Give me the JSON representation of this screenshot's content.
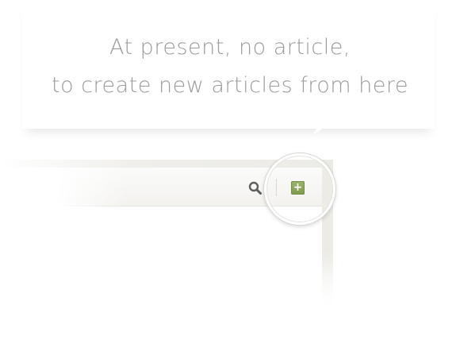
{
  "empty_state": {
    "line1": "At present, no article,",
    "line2": "to create new articles from here"
  },
  "toolbar": {
    "search_icon": "search-icon",
    "add_button_glyph": "+",
    "add_button_color": "#88a357"
  }
}
